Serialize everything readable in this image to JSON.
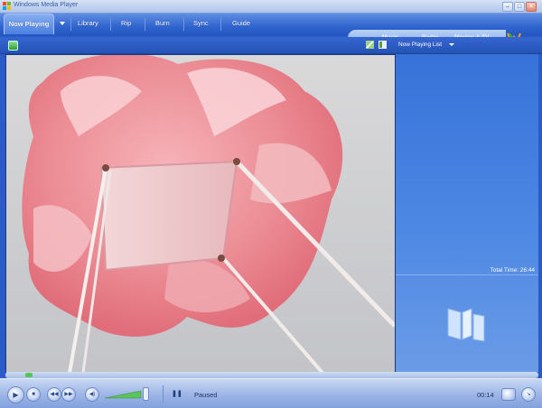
{
  "window": {
    "title": "Windows Media Player"
  },
  "nav": {
    "tabs": [
      {
        "label": "Now Playing",
        "active": true
      },
      {
        "label": "Library"
      },
      {
        "label": "Rip"
      },
      {
        "label": "Burn"
      },
      {
        "label": "Sync"
      },
      {
        "label": "Guide"
      }
    ],
    "skin_links": [
      "Music",
      "Radio",
      "Movies & TV"
    ]
  },
  "subbar": {
    "playlist_label": "Now Playing List"
  },
  "right_panel": {
    "total_time": "Total Time: 26:44"
  },
  "status": {
    "state": "Paused",
    "time": "00:14"
  },
  "colors": {
    "accent": "#2f63cd",
    "panel": "#4d88e4"
  },
  "icons": {
    "minimize": "minimize-icon",
    "maximize": "maximize-icon",
    "close": "close-icon",
    "play": "play-icon",
    "stop": "stop-icon",
    "prev": "previous-icon",
    "next": "next-icon",
    "mute": "mute-icon",
    "pause_small": "pause-icon",
    "mini": "mini-mode-icon"
  }
}
